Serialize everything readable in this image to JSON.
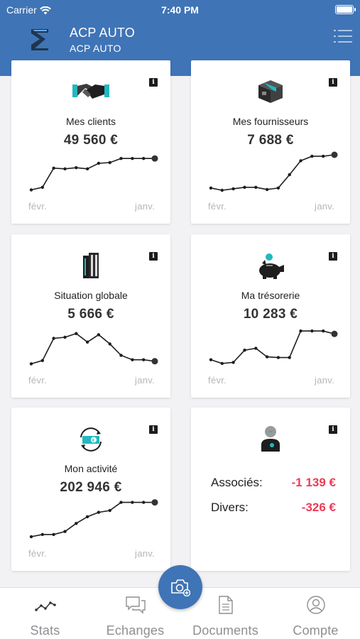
{
  "status_bar": {
    "carrier": "Carrier",
    "time": "7:40 PM"
  },
  "header": {
    "company_name": "ACP AUTO",
    "company_sub": "ACP AUTO"
  },
  "cards": [
    {
      "id": "clients",
      "title": "Mes clients",
      "value": "49 560 €",
      "icon": "handshake-icon",
      "axis_start": "févr.",
      "axis_end": "janv.",
      "trend": [
        0.03,
        0.1,
        0.62,
        0.6,
        0.63,
        0.6,
        0.75,
        0.77,
        0.88,
        0.88,
        0.88,
        0.88
      ]
    },
    {
      "id": "fournisseurs",
      "title": "Mes fournisseurs",
      "value": "7 688 €",
      "icon": "box-icon",
      "axis_start": "févr.",
      "axis_end": "janv.",
      "trend": [
        0.08,
        0.02,
        0.06,
        0.1,
        0.1,
        0.04,
        0.08,
        0.44,
        0.82,
        0.94,
        0.94,
        0.98
      ]
    },
    {
      "id": "situation",
      "title": "Situation globale",
      "value": "5 666 €",
      "icon": "building-icon",
      "axis_start": "févr.",
      "axis_end": "janv.",
      "trend": [
        0.03,
        0.12,
        0.72,
        0.75,
        0.85,
        0.62,
        0.82,
        0.57,
        0.26,
        0.14,
        0.14,
        0.1
      ]
    },
    {
      "id": "tresorerie",
      "title": "Ma trésorerie",
      "value": "10 283 €",
      "icon": "piggy-bank-icon",
      "axis_start": "févr.",
      "axis_end": "janv.",
      "trend": [
        0.14,
        0.04,
        0.07,
        0.4,
        0.45,
        0.22,
        0.2,
        0.2,
        0.92,
        0.92,
        0.92,
        0.84
      ]
    },
    {
      "id": "activite",
      "title": "Mon activité",
      "value": "202 946 €",
      "icon": "money-cycle-icon",
      "axis_start": "févr.",
      "axis_end": "janv.",
      "trend": [
        0.04,
        0.1,
        0.1,
        0.18,
        0.4,
        0.58,
        0.7,
        0.75,
        0.97,
        0.97,
        0.97,
        0.97
      ]
    }
  ],
  "balances": {
    "icon": "associate-avatar-icon",
    "rows": [
      {
        "label": "Associés:",
        "value": "-1 139 €"
      },
      {
        "label": "Divers:",
        "value": "-326 €"
      }
    ]
  },
  "tabbar": {
    "tabs": [
      {
        "label": "Stats",
        "icon": "stats-icon"
      },
      {
        "label": "Echanges",
        "icon": "chat-icon"
      },
      {
        "label": "Documents",
        "icon": "document-icon"
      },
      {
        "label": "Compte",
        "icon": "account-icon"
      }
    ],
    "fab_icon": "camera-add-icon"
  },
  "colors": {
    "brand_blue": "#3f74b6",
    "negative_red": "#ee3b57",
    "accent_teal": "#22b8c0"
  }
}
